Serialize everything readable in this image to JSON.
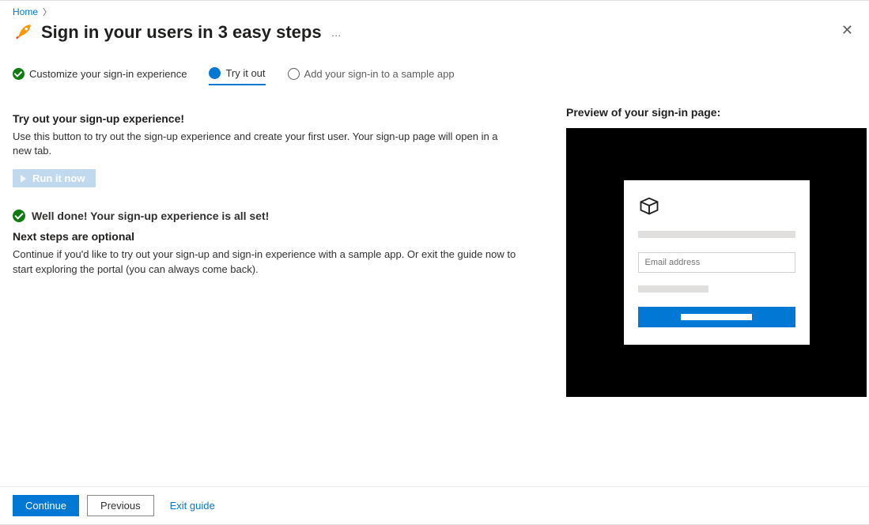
{
  "breadcrumb": {
    "home": "Home"
  },
  "page": {
    "title": "Sign in your users in 3 easy steps",
    "more_label": "…",
    "close_label": "✕"
  },
  "wizard": {
    "step1": "Customize your sign-in experience",
    "step2": "Try it out",
    "step3": "Add your sign-in to a sample app"
  },
  "left": {
    "heading1": "Try out your sign-up experience!",
    "para1": "Use this button to try out the sign-up experience and create your first user. Your sign-up page will open in a new tab.",
    "run_btn": "Run it now",
    "well_done": "Well done! Your sign-up experience is all set!",
    "heading2": "Next steps are optional",
    "para2": "Continue if you'd like to try out your sign-up and sign-in experience with a sample app. Or exit the guide now to start exploring the portal (you can always come back)."
  },
  "right": {
    "preview_title": "Preview of your sign-in page:",
    "email_placeholder": "Email address"
  },
  "footer": {
    "continue": "Continue",
    "previous": "Previous",
    "exit": "Exit guide"
  }
}
